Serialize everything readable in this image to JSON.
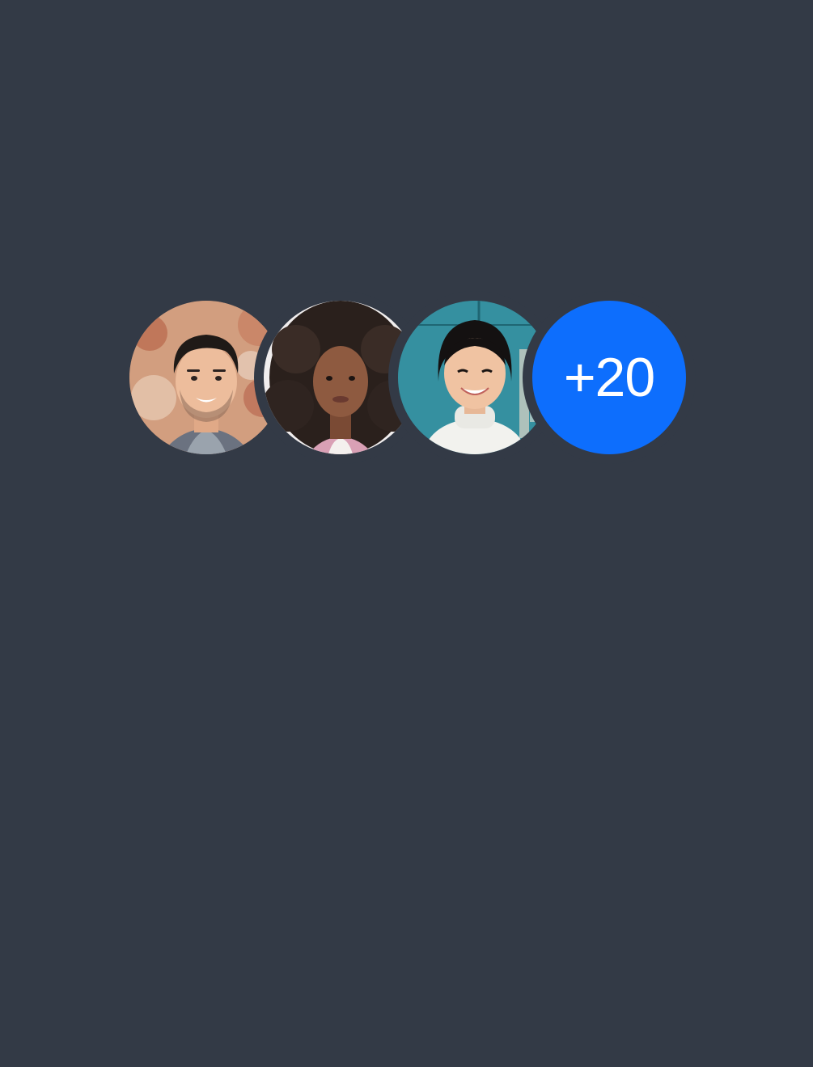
{
  "avatar_group": {
    "avatars": [
      {
        "name": "avatar-man-brick-wall"
      },
      {
        "name": "avatar-woman-curly-hair"
      },
      {
        "name": "avatar-woman-teal-door"
      }
    ],
    "more_count_label": "+20",
    "more_color": "#0d6efd",
    "background_color": "#333a46"
  }
}
